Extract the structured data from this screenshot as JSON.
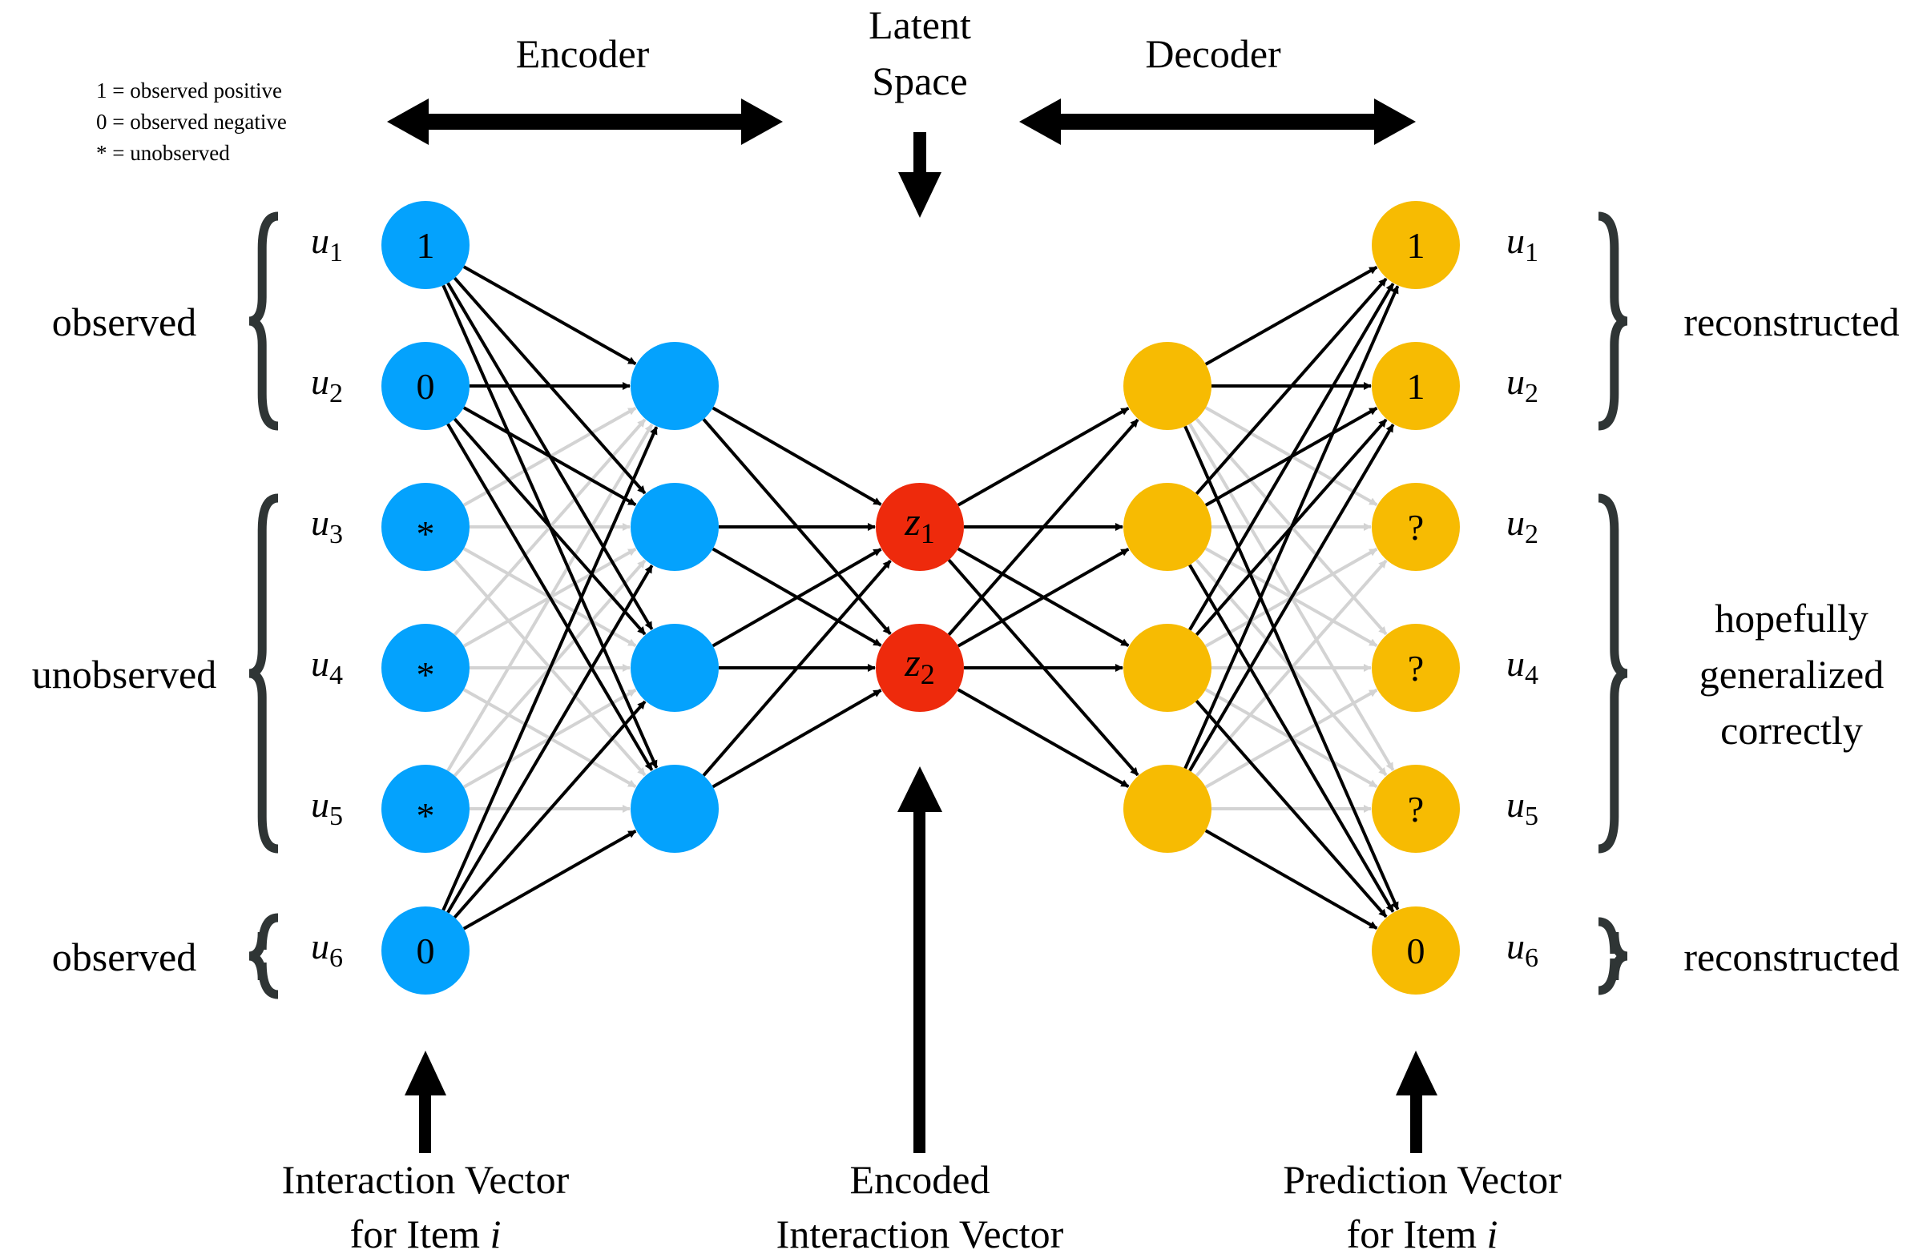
{
  "legend": [
    "1 = observed positive",
    "0 = observed negative",
    "* = unobserved"
  ],
  "headers": {
    "encoder": "Encoder",
    "latent_line1": "Latent",
    "latent_line2": "Space",
    "decoder": "Decoder"
  },
  "colors": {
    "input_node": "#04A2FD",
    "latent_node": "#EE2A0C",
    "output_node": "#F7BB02",
    "edge_observed": "#000000",
    "edge_unobserved": "#D3D3D3",
    "brace": "#2F3535"
  },
  "left_groups": [
    {
      "label": "observed",
      "rows": [
        0,
        1
      ]
    },
    {
      "label": "unobserved",
      "rows": [
        2,
        3,
        4
      ]
    },
    {
      "label": "observed",
      "rows": [
        5
      ]
    }
  ],
  "right_groups": [
    {
      "label_lines": [
        "reconstructed"
      ],
      "rows": [
        0,
        1
      ]
    },
    {
      "label_lines": [
        "hopefully",
        "generalized",
        "correctly"
      ],
      "rows": [
        2,
        3,
        4
      ]
    },
    {
      "label_lines": [
        "reconstructed"
      ],
      "rows": [
        5
      ]
    }
  ],
  "input_layer": [
    {
      "label": "u",
      "sub": "1",
      "value": "1",
      "observed": true
    },
    {
      "label": "u",
      "sub": "2",
      "value": "0",
      "observed": true
    },
    {
      "label": "u",
      "sub": "3",
      "value": "*",
      "observed": false
    },
    {
      "label": "u",
      "sub": "4",
      "value": "*",
      "observed": false
    },
    {
      "label": "u",
      "sub": "5",
      "value": "*",
      "observed": false
    },
    {
      "label": "u",
      "sub": "6",
      "value": "0",
      "observed": true
    }
  ],
  "encoder_hidden_count": 4,
  "latent_layer": [
    {
      "label": "z",
      "sub": "1"
    },
    {
      "label": "z",
      "sub": "2"
    }
  ],
  "decoder_hidden_count": 4,
  "output_layer": [
    {
      "label": "u",
      "sub": "1",
      "value": "1",
      "observed": true
    },
    {
      "label": "u",
      "sub": "2",
      "value": "1",
      "observed": true
    },
    {
      "label": "u",
      "sub": "2",
      "value": "?",
      "observed": false
    },
    {
      "label": "u",
      "sub": "4",
      "value": "?",
      "observed": false
    },
    {
      "label": "u",
      "sub": "5",
      "value": "?",
      "observed": false
    },
    {
      "label": "u",
      "sub": "6",
      "value": "0",
      "observed": true
    }
  ],
  "bottom_labels": {
    "input": {
      "line1": "Interaction Vector",
      "line2_prefix": "for Item ",
      "line2_italic": "i"
    },
    "latent": {
      "line1": "Encoded",
      "line2": "Interaction Vector"
    },
    "output": {
      "line1": "Prediction Vector",
      "line2_prefix": "for Item ",
      "line2_italic": "i"
    }
  }
}
